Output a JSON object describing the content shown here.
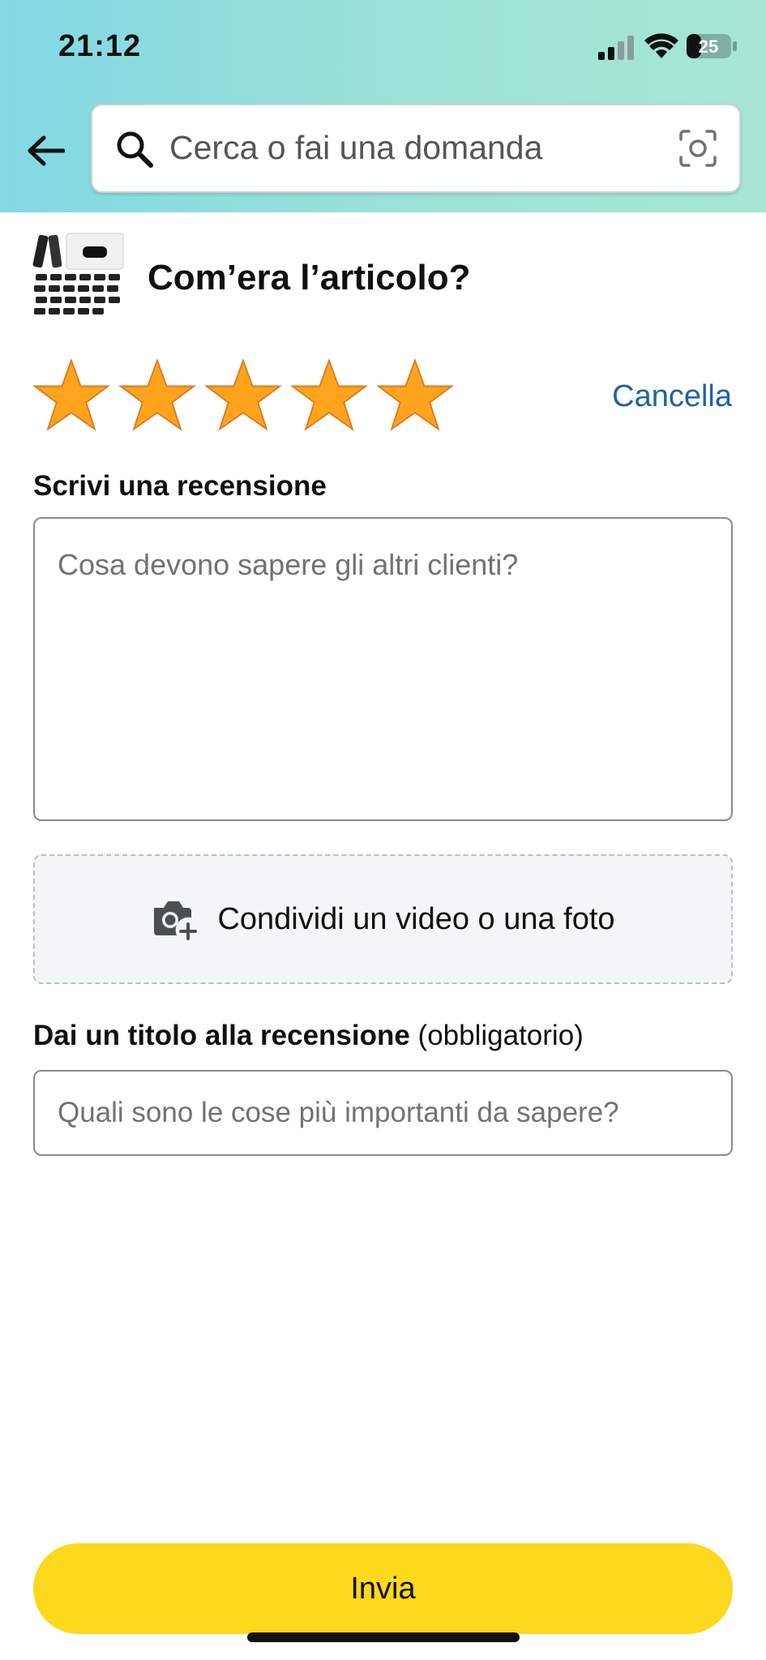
{
  "status_bar": {
    "time": "21:12",
    "battery": "25"
  },
  "search": {
    "placeholder": "Cerca o fai una domanda"
  },
  "review": {
    "question": "Com’era l’articolo?",
    "rating": 5,
    "rating_max": 5,
    "cancel_label": "Cancella",
    "write_label": "Scrivi una recensione",
    "write_placeholder": "Cosa devono sapere gli altri clienti?",
    "media_label": "Condividi un video o una foto",
    "title_label_bold": "Dai un titolo alla recensione",
    "title_label_note": " (obbligatorio)",
    "title_placeholder": "Quali sono le cose più importanti da sapere?",
    "submit_label": "Invia"
  },
  "colors": {
    "header_start": "#82d8e3",
    "header_end": "#a6e6d3",
    "star": "#ffa41c",
    "link": "#2162a1",
    "submit": "#fcd91c"
  }
}
